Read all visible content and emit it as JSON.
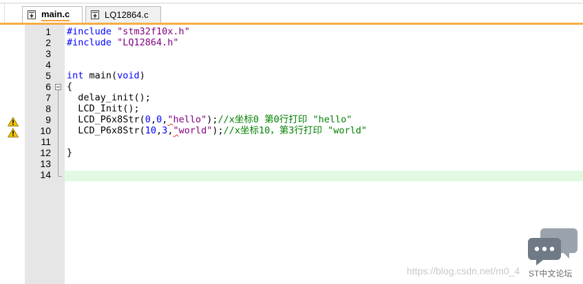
{
  "tabs": [
    {
      "label": "main.c",
      "active": true,
      "icon": "c-file-icon"
    },
    {
      "label": "LQ12864.c",
      "active": false,
      "icon": "c-file-icon"
    }
  ],
  "colors": {
    "accent_tab_line": "#f5ad44",
    "current_line_highlight": "#e2fae4",
    "gutter": "#e6e6e6",
    "keyword": "#0000ff",
    "string": "#800080",
    "comment": "#008000",
    "warning": "#f2c200"
  },
  "warnings_on_lines": [
    9,
    10
  ],
  "current_line": 14,
  "lines": [
    {
      "num": "1",
      "tokens": [
        {
          "t": "#include ",
          "c": "pp"
        },
        {
          "t": "\"stm32f10x.h\"",
          "c": "str"
        }
      ]
    },
    {
      "num": "2",
      "tokens": [
        {
          "t": "#include ",
          "c": "pp"
        },
        {
          "t": "\"LQ12864.h\"",
          "c": "str"
        }
      ]
    },
    {
      "num": "3",
      "tokens": []
    },
    {
      "num": "4",
      "tokens": []
    },
    {
      "num": "5",
      "tokens": [
        {
          "t": "int",
          "c": "kw"
        },
        {
          "t": " main(",
          "c": ""
        },
        {
          "t": "void",
          "c": "kw"
        },
        {
          "t": ")",
          "c": ""
        }
      ]
    },
    {
      "num": "6",
      "tokens": [
        {
          "t": "{",
          "c": ""
        }
      ]
    },
    {
      "num": "7",
      "tokens": [
        {
          "t": "  delay_init();",
          "c": ""
        }
      ]
    },
    {
      "num": "8",
      "tokens": [
        {
          "t": "  LCD_Init();",
          "c": ""
        }
      ]
    },
    {
      "num": "9",
      "tokens": [
        {
          "t": "  LCD_P6x8Str(",
          "c": ""
        },
        {
          "t": "0",
          "c": "num"
        },
        {
          "t": ",",
          "c": ""
        },
        {
          "t": "0",
          "c": "num"
        },
        {
          "t": ",",
          "c": ""
        },
        {
          "t": "\"",
          "c": "str squig"
        },
        {
          "t": "hello\"",
          "c": "str"
        },
        {
          "t": ");",
          "c": ""
        },
        {
          "t": "//x坐标0 第0行打印 \"hello\"",
          "c": "cmt"
        }
      ]
    },
    {
      "num": "10",
      "tokens": [
        {
          "t": "  LCD_P6x8Str(",
          "c": ""
        },
        {
          "t": "10",
          "c": "num"
        },
        {
          "t": ",",
          "c": ""
        },
        {
          "t": "3",
          "c": "num"
        },
        {
          "t": ",",
          "c": ""
        },
        {
          "t": "\"",
          "c": "str squig"
        },
        {
          "t": "world\"",
          "c": "str"
        },
        {
          "t": ");",
          "c": ""
        },
        {
          "t": "//x坐标10，第3行打印 \"world\"",
          "c": "cmt"
        }
      ]
    },
    {
      "num": "11",
      "tokens": []
    },
    {
      "num": "12",
      "tokens": [
        {
          "t": "}",
          "c": ""
        }
      ]
    },
    {
      "num": "13",
      "tokens": []
    },
    {
      "num": "14",
      "tokens": []
    }
  ],
  "watermark": {
    "url": "https://blog.csdn.net/m0_4",
    "brand": "ST中文论坛"
  }
}
